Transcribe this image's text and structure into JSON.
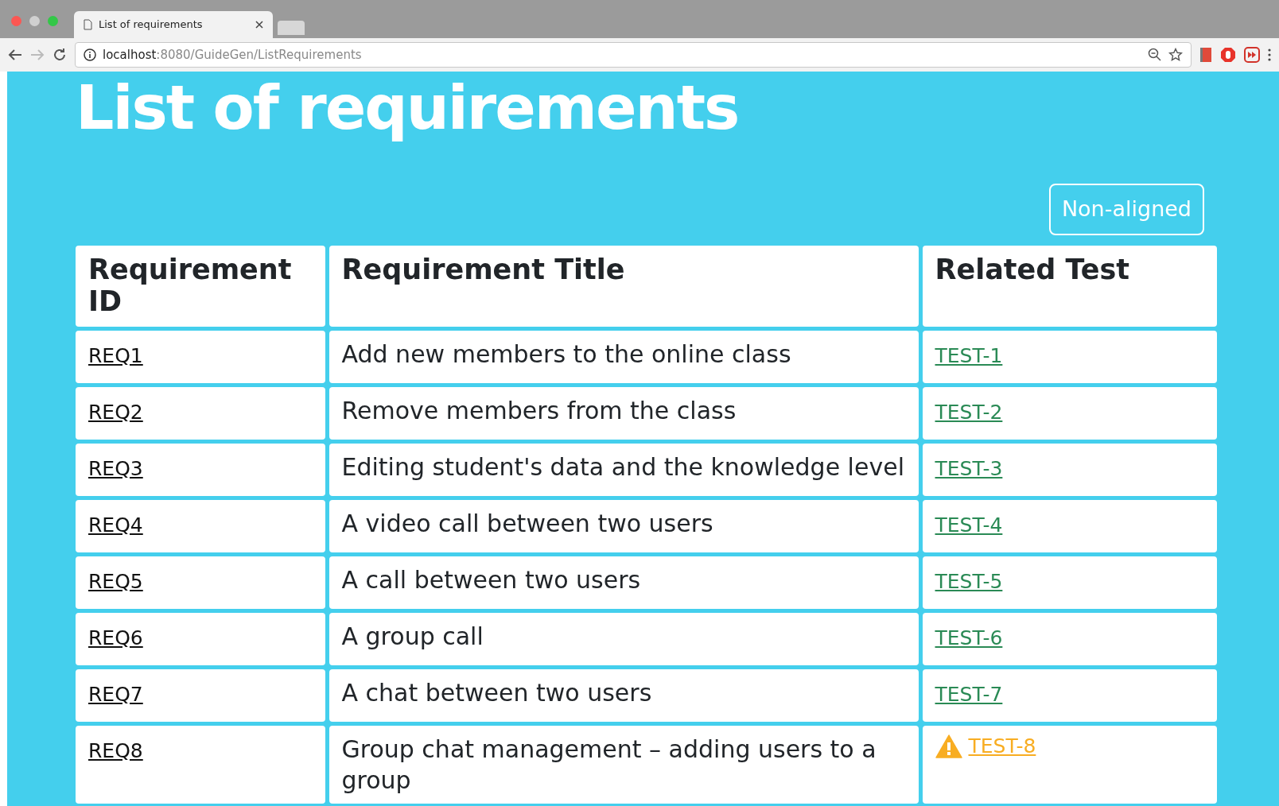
{
  "browser": {
    "tab_title": "List of requirements",
    "url_host": "localhost",
    "url_path": ":8080/GuideGen/ListRequirements"
  },
  "page_title": "List of requirements",
  "filter_button": "Non-aligned",
  "table": {
    "columns": [
      "Requirement ID",
      "Requirement Title",
      "Related Test"
    ],
    "rows": [
      {
        "id": "REQ1",
        "title": "Add new members to the online class",
        "test": "TEST-1",
        "warning": false
      },
      {
        "id": "REQ2",
        "title": "Remove members from the class",
        "test": "TEST-2",
        "warning": false
      },
      {
        "id": "REQ3",
        "title": "Editing student's data and the knowledge level",
        "test": "TEST-3",
        "warning": false
      },
      {
        "id": "REQ4",
        "title": "A video call between two users",
        "test": "TEST-4",
        "warning": false
      },
      {
        "id": "REQ5",
        "title": "A call between two users",
        "test": "TEST-5",
        "warning": false
      },
      {
        "id": "REQ6",
        "title": "A group call",
        "test": "TEST-6",
        "warning": false
      },
      {
        "id": "REQ7",
        "title": "A chat between two users",
        "test": "TEST-7",
        "warning": false
      },
      {
        "id": "REQ8",
        "title": "Group chat management – adding users to a group",
        "test": "TEST-8",
        "warning": true
      }
    ]
  }
}
